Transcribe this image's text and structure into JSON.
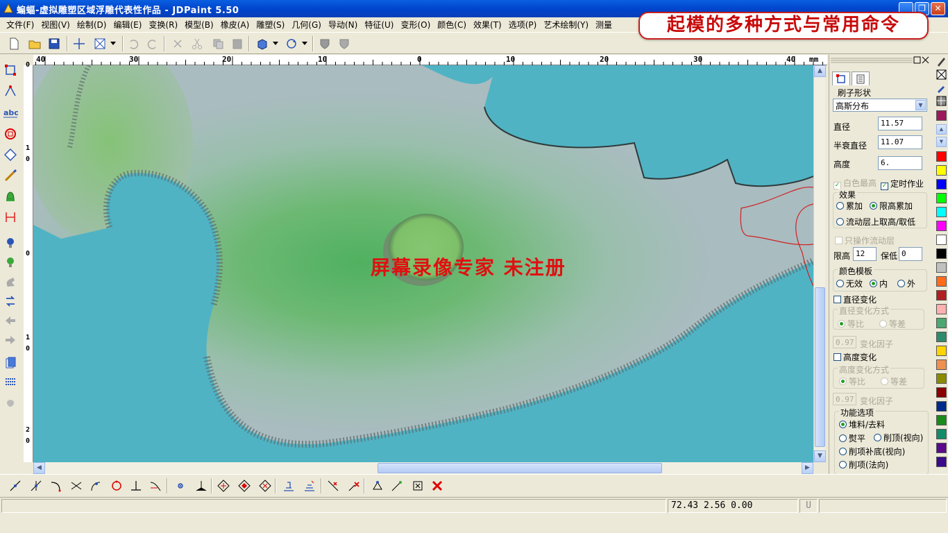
{
  "window": {
    "title": "蝙蝠-虚拟雕塑区域浮雕代表性作品 - JDPaint 5.50",
    "minimize": "_",
    "maximize": "❐",
    "close": "✕"
  },
  "banner": {
    "text": "起模的多种方式与常用命令"
  },
  "menu": [
    "文件(F)",
    "视图(V)",
    "绘制(D)",
    "编辑(E)",
    "变换(R)",
    "模型(B)",
    "橡皮(A)",
    "雕塑(S)",
    "几何(G)",
    "导动(N)",
    "特征(U)",
    "变形(O)",
    "颜色(C)",
    "效果(T)",
    "选项(P)",
    "艺术绘制(Y)",
    "测量"
  ],
  "ruler": {
    "unit": "mm",
    "labels": [
      "40",
      "30",
      "20",
      "10",
      "0",
      "10",
      "20",
      "30",
      "40"
    ],
    "vlabels": [
      "0",
      "1",
      "0",
      "0",
      "1",
      "0",
      "2",
      "0"
    ]
  },
  "viewport": {
    "watermark": "屏幕录像专家  未注册"
  },
  "panel": {
    "brush_shape_label": "刷子形状",
    "brush_shape_value": "高斯分布",
    "diameter_label": "直径",
    "diameter_value": "11.57",
    "half_decay_label": "半衰直径",
    "half_decay_value": "11.07",
    "height_label": "高度",
    "height_value": "6.",
    "white_highest": "白色最高",
    "timed_job": "定时作业",
    "effect_label": "效果",
    "accumulate": "累加",
    "limit_accumulate": "限高累加",
    "flow_layer": "流动层上取高/取低",
    "only_flow": "只操作流动层",
    "limit_high_label": "限高",
    "limit_high_value": "12",
    "keep_low_label": "保低",
    "keep_low_value": "0",
    "color_template_label": "颜色模板",
    "none": "无效",
    "inner": "内",
    "outer": "外",
    "diameter_change": "直径变化",
    "diameter_change_mode": "直径变化方式",
    "ratio": "等比",
    "diff": "等差",
    "factor_value": "0.97",
    "factor_label": "变化因子",
    "height_change": "高度变化",
    "height_change_mode": "高度变化方式",
    "ratio2": "等比",
    "diff2": "等差",
    "factor_value2": "0.97",
    "factor_label2": "变化因子",
    "func_label": "功能选项",
    "pile_cut": "堆料/去料",
    "flatten": "熨平",
    "cut_top_view": "削顶(视向)",
    "cut_top_fill": "削项补底(视向)",
    "cut_top_normal": "削项(法向)"
  },
  "palette": [
    "#9c1a5c",
    "#ff0000",
    "#ffff00",
    "#0000ff",
    "#00ff00",
    "#00ffff",
    "#ff00ff",
    "#ffffff",
    "#000000",
    "#c0c0c0",
    "#ff6b1a",
    "#b02020",
    "#ffb0b0",
    "#4aa870",
    "#2e8b6b",
    "#ffd400",
    "#f09050",
    "#8b8b00",
    "#8b0000",
    "#002b8b",
    "#1a8b1a",
    "#138b6b",
    "#5a0a8b",
    "#3a0a8b"
  ],
  "status": {
    "coords": "72.43 2.56 0.00",
    "u": "U"
  }
}
